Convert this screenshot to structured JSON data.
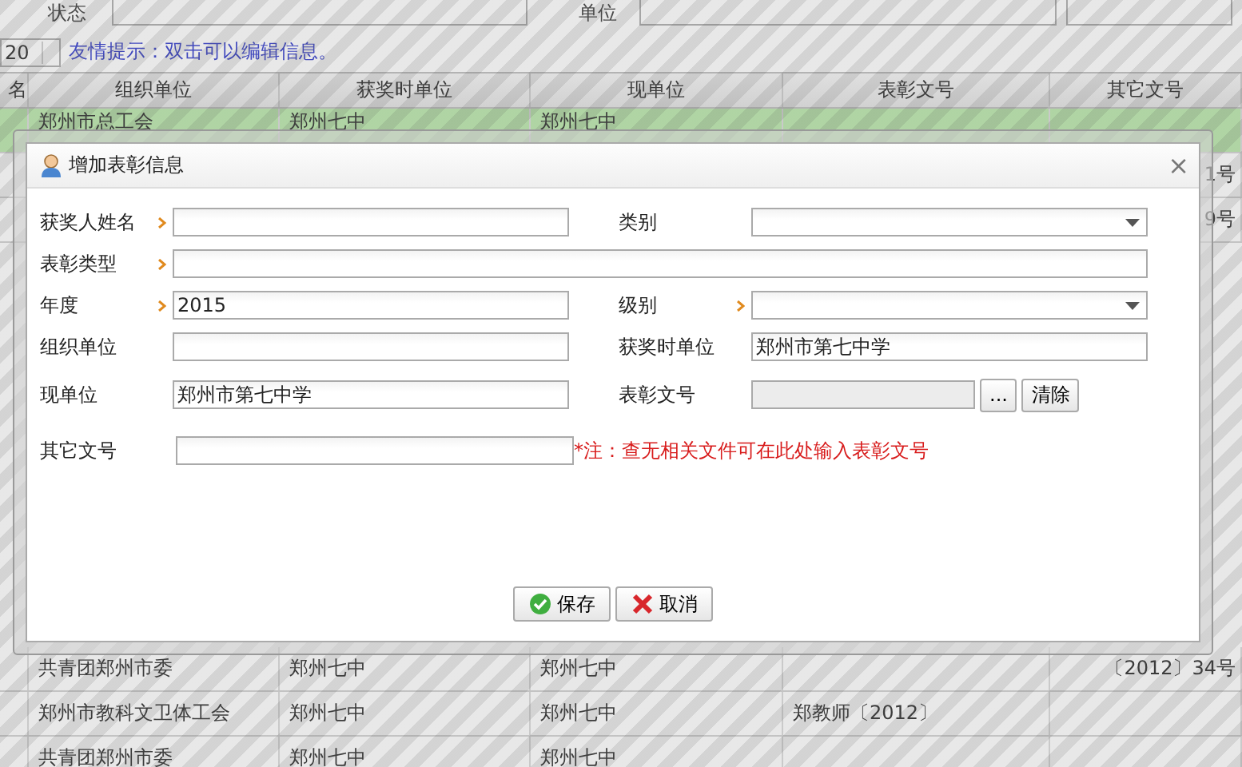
{
  "filter_bar": {
    "status_label": "状态",
    "unit_label": "单位"
  },
  "toolbar": {
    "page_size": "20",
    "hint": "友情提示：双击可以编辑信息。"
  },
  "table": {
    "columns": [
      "名",
      "组织单位",
      "获奖时单位",
      "现单位",
      "表彰文号",
      "其它文号"
    ],
    "top_rows": [
      {
        "selected": true,
        "cells": [
          "",
          "郑州市总工会",
          "郑州七中",
          "郑州七中",
          "",
          ""
        ]
      },
      {
        "selected": false,
        "cells": [
          "",
          "",
          "",
          "",
          "",
          "1号"
        ]
      },
      {
        "selected": false,
        "cells": [
          "",
          "",
          "",
          "",
          "",
          "9号"
        ]
      }
    ],
    "bottom_rows": [
      {
        "selected": false,
        "cells": [
          "",
          "共青团郑州市委",
          "郑州七中",
          "郑州七中",
          "",
          "〔2012〕34号"
        ]
      },
      {
        "selected": false,
        "cells": [
          "",
          "郑州市教科文卫体工会",
          "郑州七中",
          "郑州七中",
          "郑教师〔2012〕",
          ""
        ]
      },
      {
        "selected": false,
        "cells": [
          "",
          "共青团郑州市委",
          "郑州七中",
          "郑州七中",
          "",
          ""
        ]
      }
    ]
  },
  "dialog": {
    "title": "增加表彰信息",
    "close": "×",
    "fields": [
      {
        "label": "获奖人姓名",
        "kind": "text",
        "required": true
      },
      {
        "label": "类别",
        "kind": "select",
        "required": false
      },
      {
        "label": "表彰类型",
        "kind": "text",
        "required": true,
        "wide": true
      },
      {
        "label": "年度",
        "kind": "text",
        "required": true,
        "value": "2015"
      },
      {
        "label": "级别",
        "kind": "select",
        "required": true
      },
      {
        "label": "组织单位",
        "kind": "text",
        "required": false
      },
      {
        "label": "获奖时单位",
        "kind": "text",
        "required": false,
        "value": "郑州市第七中学"
      },
      {
        "label": "现单位",
        "kind": "text",
        "required": false,
        "value": "郑州市第七中学"
      },
      {
        "label": "表彰文号",
        "kind": "lookup",
        "required": false,
        "disabled": true,
        "pick": "...",
        "clear": "清除"
      },
      {
        "label": "其它文号",
        "kind": "text",
        "required": false
      }
    ],
    "note": "*注：查无相关文件可在此处输入表彰文号",
    "buttons": [
      {
        "label": "保存",
        "kind": "save"
      },
      {
        "label": "取消",
        "kind": "cancel"
      }
    ]
  }
}
